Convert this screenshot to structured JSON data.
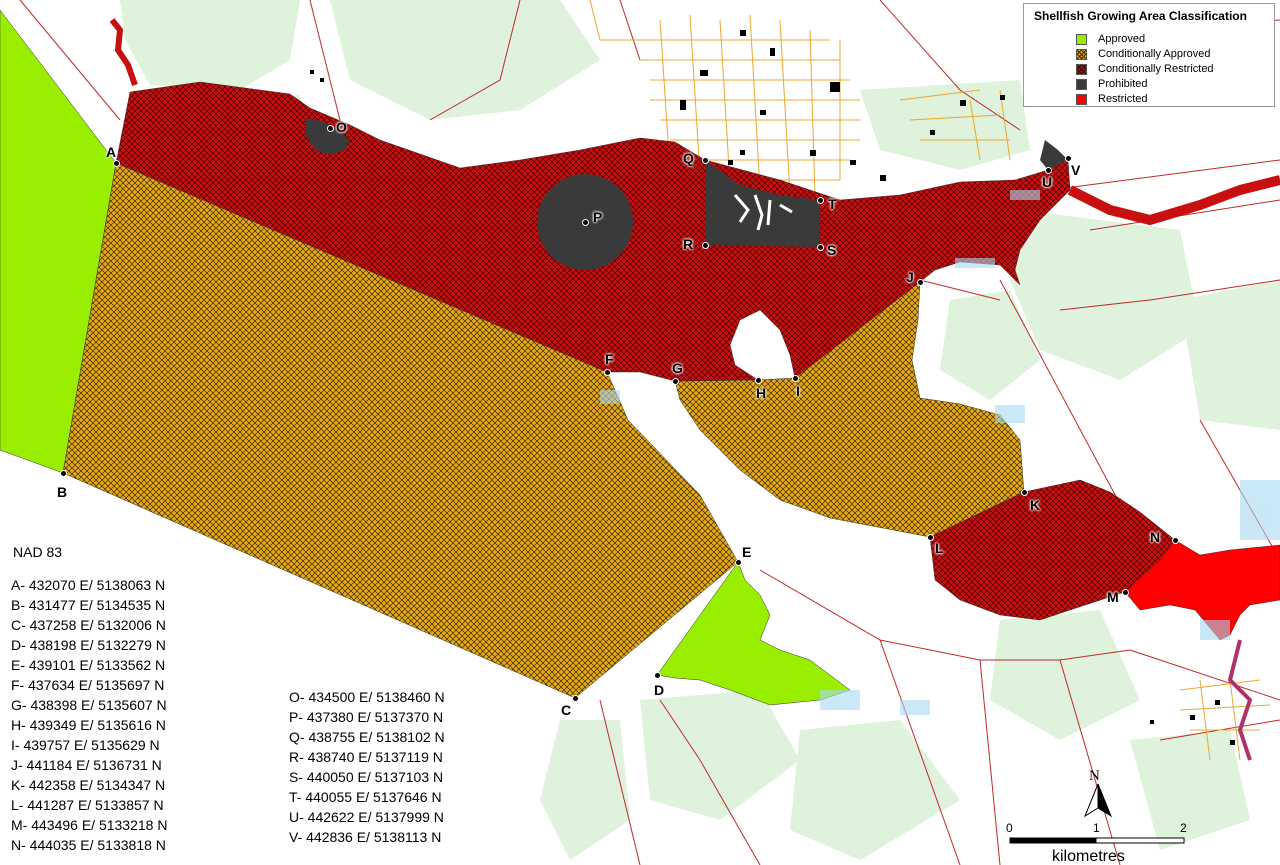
{
  "legend": {
    "title": "Shellfish Growing Area Classification",
    "items": [
      {
        "label": "Approved",
        "color": "#99ee00",
        "hatch": false
      },
      {
        "label": "Conditionally Approved",
        "color": "#e7a818",
        "hatch": true
      },
      {
        "label": "Conditionally Restricted",
        "color": "#c81010",
        "hatch": true
      },
      {
        "label": "Prohibited",
        "color": "#3a3a3a",
        "hatch": false
      },
      {
        "label": "Restricted",
        "color": "#ff0000",
        "hatch": false
      }
    ]
  },
  "points": {
    "A": "A",
    "B": "B",
    "C": "C",
    "D": "D",
    "E": "E",
    "F": "F",
    "G": "G",
    "H": "H",
    "I": "I",
    "J": "J",
    "K": "K",
    "L": "L",
    "M": "M",
    "N": "N",
    "O": "O",
    "P": "P",
    "Q": "Q",
    "R": "R",
    "S": "S",
    "T": "T",
    "U": "U",
    "V": "V"
  },
  "datum": "NAD 83",
  "coordinates_left": [
    "A- 432070 E/ 5138063 N",
    "B- 431477 E/ 5134535 N",
    "C- 437258 E/ 5132006 N",
    "D- 438198 E/ 5132279 N",
    "E- 439101 E/ 5133562 N",
    "F- 437634 E/ 5135697 N",
    "G- 438398 E/ 5135607 N",
    "H- 439349 E/ 5135616 N",
    "I-  439757 E/ 5135629 N",
    "J- 441184 E/ 5136731 N",
    "K- 442358 E/ 5134347 N",
    "L- 441287 E/ 5133857 N",
    "M- 443496 E/ 5133218 N",
    "N- 444035 E/ 5133818 N"
  ],
  "coordinates_right": [
    "O- 434500 E/ 5138460 N",
    "P- 437380 E/ 5137370 N",
    "Q- 438755 E/ 5138102 N",
    "R- 438740 E/ 5137119 N",
    "S- 440050 E/ 5137103 N",
    "T- 440055 E/ 5137646 N",
    "U- 442622 E/ 5137999 N",
    "V- 442836 E/ 5138113 N"
  ],
  "north": "N",
  "scale": {
    "ticks": [
      "0",
      "1",
      "2"
    ],
    "unit": "kilometres"
  },
  "colors": {
    "approved": "#99ee00",
    "conditionally_approved": "#e7a818",
    "conditionally_restricted": "#c81010",
    "prohibited": "#3a3a3a",
    "restricted": "#ff0000",
    "land": "#ffffff",
    "vegetation": "#dff2dc",
    "town_streets": "#e8a830",
    "roads": "#c02828"
  }
}
